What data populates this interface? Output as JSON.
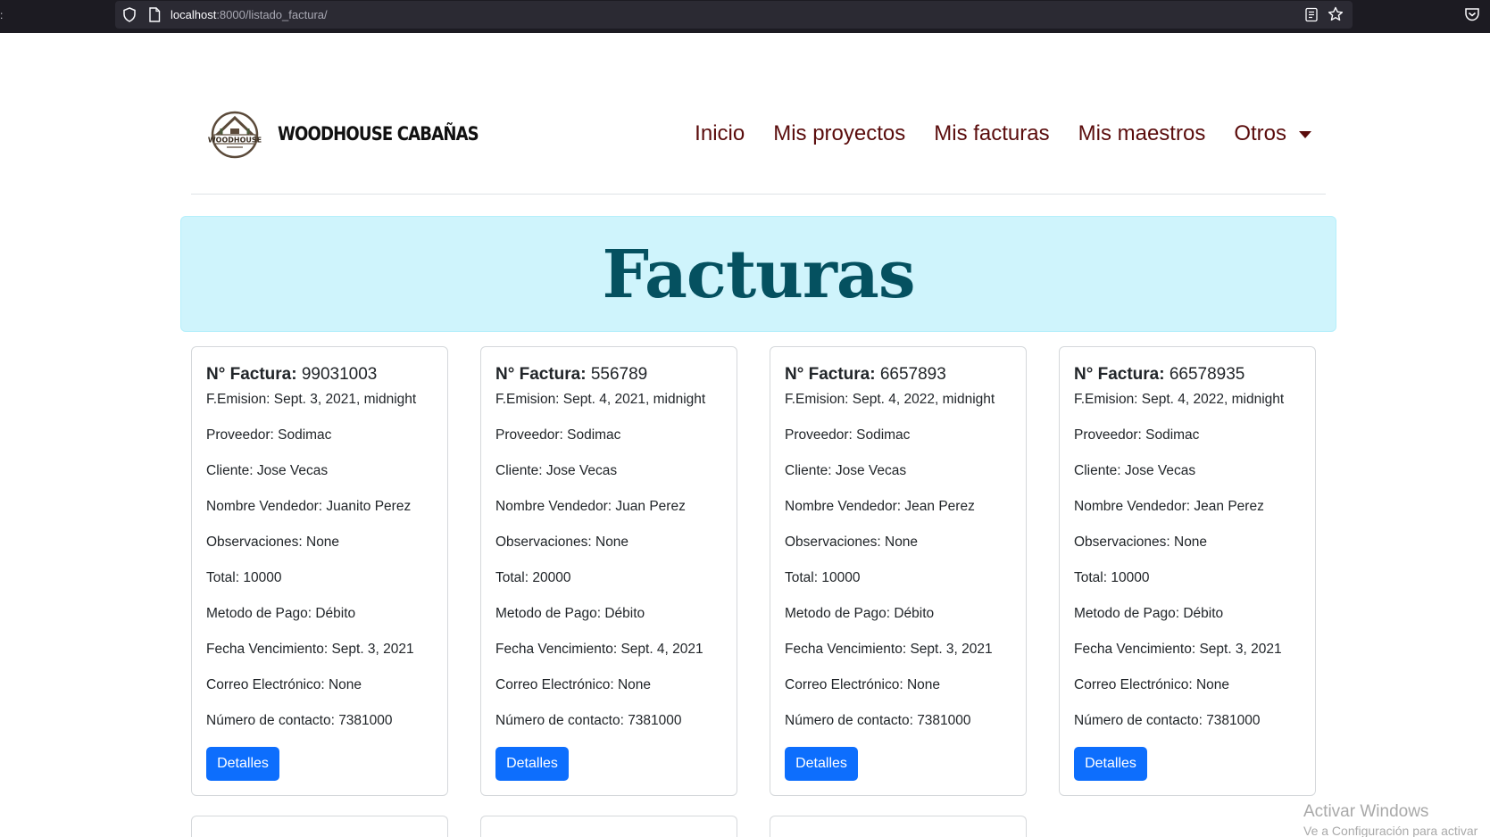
{
  "browser": {
    "url_host": "localhost",
    "url_path": ":8000/listado_factura/"
  },
  "navbar": {
    "brand": "WOODHOUSE CABAÑAS",
    "logo_text": "WOODHOUSE",
    "items": [
      {
        "label": "Inicio"
      },
      {
        "label": "Mis proyectos"
      },
      {
        "label": "Mis facturas"
      },
      {
        "label": "Mis maestros"
      },
      {
        "label": "Otros"
      }
    ]
  },
  "banner": {
    "title": "Facturas"
  },
  "labels": {
    "factura": "N° Factura:",
    "button": "Detalles"
  },
  "cards": [
    {
      "numero": "99031003",
      "lines": [
        "F.Emision: Sept. 3, 2021, midnight",
        "Proveedor: Sodimac",
        "Cliente: Jose Vecas",
        "Nombre Vendedor: Juanito Perez",
        "Observaciones: None",
        "Total: 10000",
        "Metodo de Pago: Débito",
        "Fecha Vencimiento: Sept. 3, 2021",
        "Correo Electrónico: None",
        "Número de contacto: 7381000"
      ]
    },
    {
      "numero": "556789",
      "lines": [
        "F.Emision: Sept. 4, 2021, midnight",
        "Proveedor: Sodimac",
        "Cliente: Jose Vecas",
        "Nombre Vendedor: Juan Perez",
        "Observaciones: None",
        "Total: 20000",
        "Metodo de Pago: Débito",
        "Fecha Vencimiento: Sept. 4, 2021",
        "Correo Electrónico: None",
        "Número de contacto: 7381000"
      ]
    },
    {
      "numero": "6657893",
      "lines": [
        "F.Emision: Sept. 4, 2022, midnight",
        "Proveedor: Sodimac",
        "Cliente: Jose Vecas",
        "Nombre Vendedor: Jean Perez",
        "Observaciones: None",
        "Total: 10000",
        "Metodo de Pago: Débito",
        "Fecha Vencimiento: Sept. 3, 2021",
        "Correo Electrónico: None",
        "Número de contacto: 7381000"
      ]
    },
    {
      "numero": "66578935",
      "lines": [
        "F.Emision: Sept. 4, 2022, midnight",
        "Proveedor: Sodimac",
        "Cliente: Jose Vecas",
        "Nombre Vendedor: Jean Perez",
        "Observaciones: None",
        "Total: 10000",
        "Metodo de Pago: Débito",
        "Fecha Vencimiento: Sept. 3, 2021",
        "Correo Electrónico: None",
        "Número de contacto: 7381000"
      ]
    }
  ],
  "watermark": {
    "line1": "Activar Windows",
    "line2": "Ve a Configuración para activar"
  },
  "colors": {
    "nav_link": "#5a0c0c",
    "banner_bg": "#cff4fc",
    "banner_text": "#055160",
    "button": "#0d6efd"
  }
}
